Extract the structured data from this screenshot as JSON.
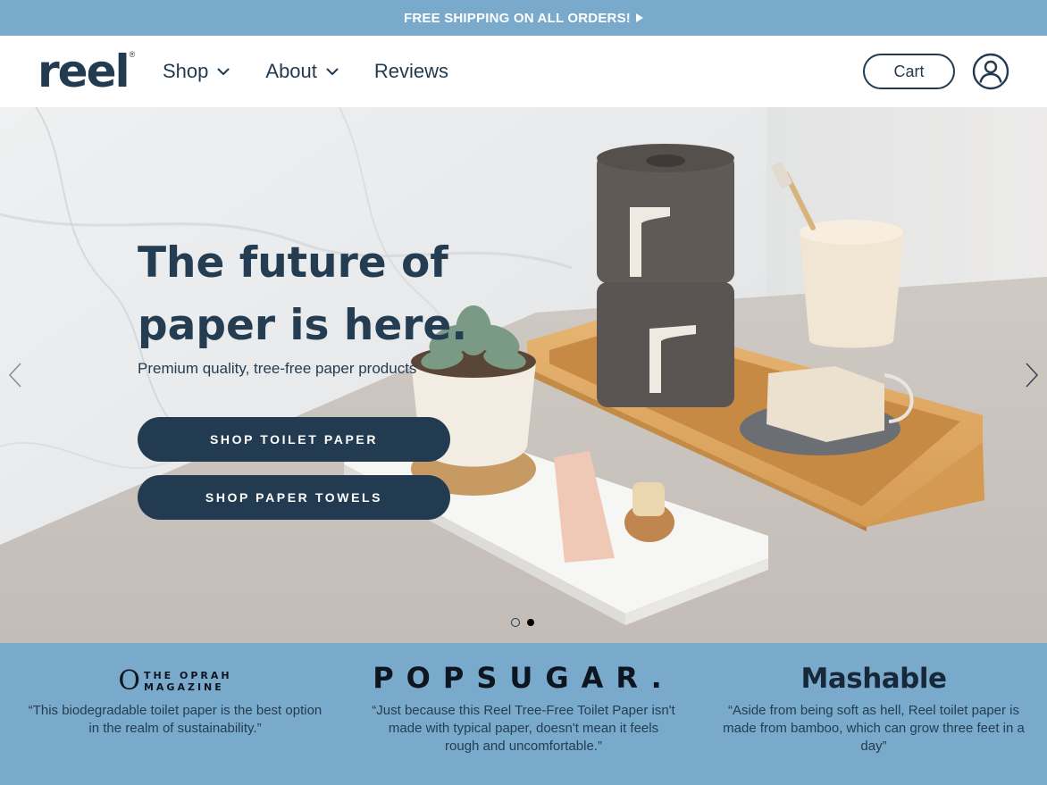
{
  "announcement": {
    "text": "FREE SHIPPING ON ALL ORDERS!"
  },
  "header": {
    "logo": "reel",
    "logo_mark": "®",
    "nav": [
      {
        "label": "Shop",
        "has_dropdown": true
      },
      {
        "label": "About",
        "has_dropdown": true
      },
      {
        "label": "Reviews",
        "has_dropdown": false
      }
    ],
    "cart_label": "Cart",
    "account_icon": "user-circle-icon"
  },
  "hero": {
    "title_line1": "The future of",
    "title_line2": "paper is here.",
    "subtitle": "Premium quality, tree-free paper products",
    "buttons": [
      {
        "label": "SHOP TOILET PAPER"
      },
      {
        "label": "SHOP PAPER TOWELS"
      }
    ],
    "prev_icon": "chevron-left-icon",
    "next_icon": "chevron-right-icon",
    "slide_count": 2,
    "active_slide": 2
  },
  "press": [
    {
      "logo_mark": "O",
      "logo_line1": "THE OPRAH",
      "logo_line2": "MAGAZINE",
      "quote": "“This biodegradable toilet paper is the best option in the realm of sustainability.”"
    },
    {
      "logo": "POPSUGAR.",
      "quote": "“Just because this Reel Tree-Free Toilet Paper isn't made with typical paper, doesn't mean it feels rough and uncomfortable.”"
    },
    {
      "logo": "Mashable",
      "quote": "“Aside from being soft as hell, Reel toilet paper is made from bamboo, which can grow three feet in a day”"
    }
  ],
  "colors": {
    "brand_navy": "#233b50",
    "light_blue": "#79aacb",
    "white": "#ffffff"
  }
}
